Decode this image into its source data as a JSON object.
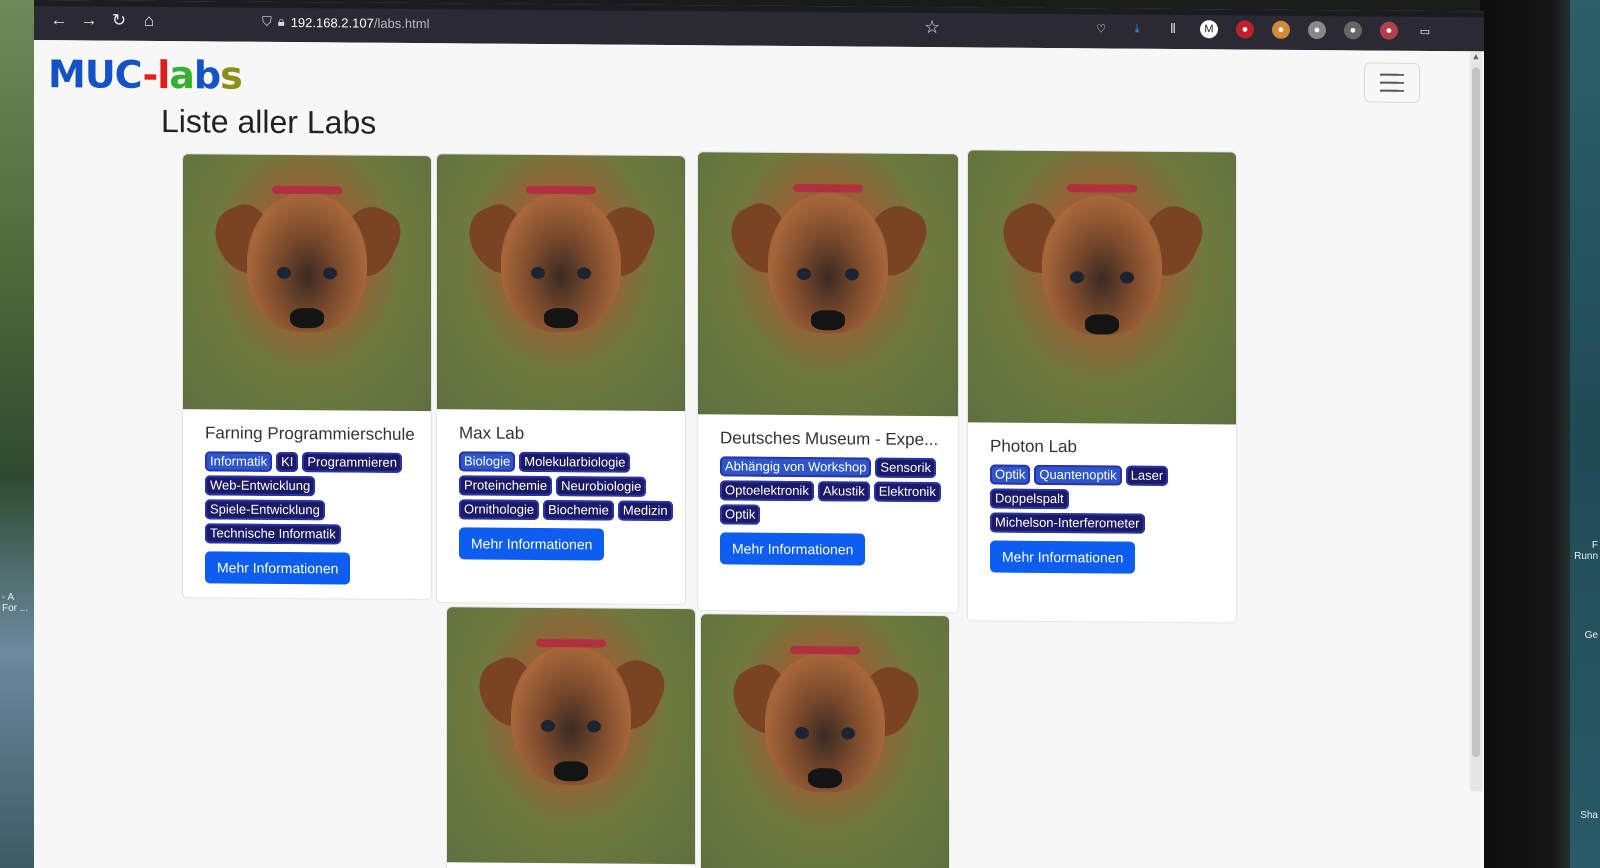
{
  "browser": {
    "url_host": "192.168.2.107",
    "url_path": "/labs.html"
  },
  "site": {
    "logo_parts": [
      "MUC",
      "-",
      "l",
      "a",
      "b",
      "s"
    ],
    "page_title": "Liste aller Labs"
  },
  "desktop": {
    "left_label_line1": "- A",
    "left_label_line2": "For ...",
    "right_label_1": "F",
    "right_label_2": "Runn",
    "right_label_3": "Ge",
    "right_label_4": "Sha"
  },
  "labs": [
    {
      "title": "Farning Programmierschule",
      "tags": [
        "Informatik",
        "KI",
        "Programmieren",
        "Web-Entwicklung",
        "Spiele-Entwicklung",
        "Technische Informatik"
      ],
      "button": "Mehr Informationen"
    },
    {
      "title": "Max Lab",
      "tags": [
        "Biologie",
        "Molekularbiologie",
        "Proteinchemie",
        "Neurobiologie",
        "Ornithologie",
        "Biochemie",
        "Medizin"
      ],
      "button": "Mehr Informationen"
    },
    {
      "title": "Deutsches Museum - Expe...",
      "tags": [
        "Abhängig von Workshop",
        "Sensorik",
        "Optoelektronik",
        "Akustik",
        "Elektronik",
        "Optik"
      ],
      "button": "Mehr Informationen"
    },
    {
      "title": "Photon Lab",
      "tags": [
        "Optik",
        "Quantenoptik",
        "Laser",
        "Doppelspalt",
        "Michelson-Interferometer"
      ],
      "button": "Mehr Informationen"
    }
  ]
}
